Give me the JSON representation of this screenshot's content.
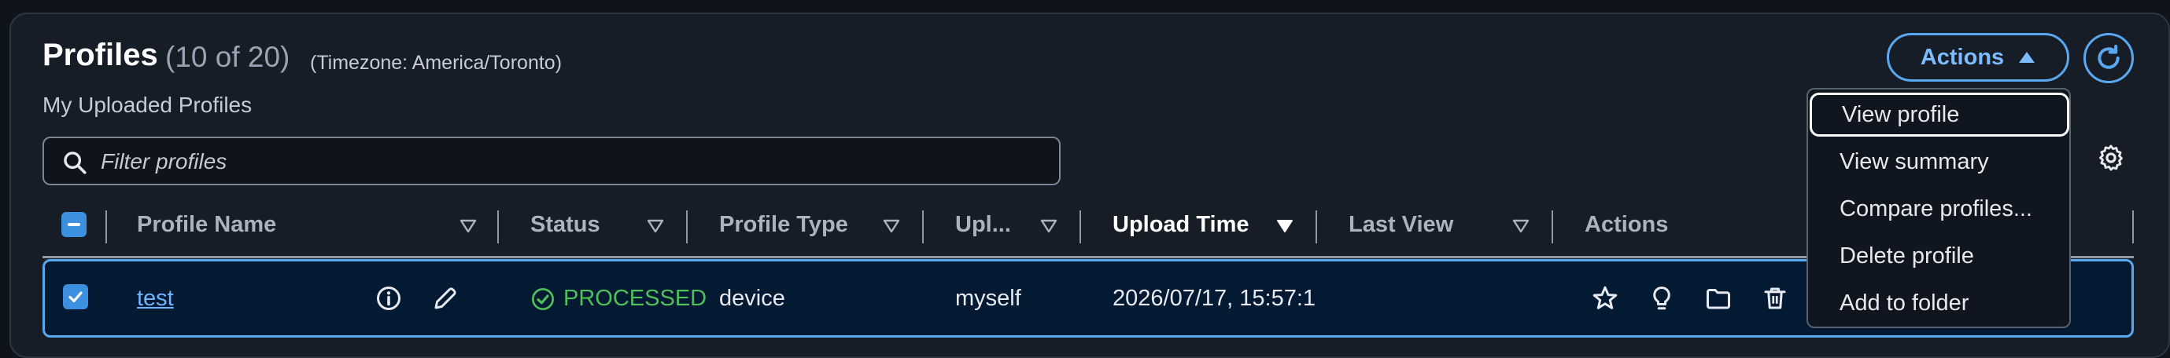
{
  "header": {
    "title": "Profiles",
    "count": "(10 of 20)",
    "timezone": "(Timezone: America/Toronto)",
    "subtitle": "My Uploaded Profiles",
    "actions_label": "Actions"
  },
  "search": {
    "placeholder": "Filter profiles",
    "value": ""
  },
  "table": {
    "columns": [
      "Profile Name",
      "Status",
      "Profile Type",
      "Upl...",
      "Upload Time",
      "Last View",
      "Actions"
    ],
    "sorted_column": "Upload Time",
    "header_checkbox": "indeterminate",
    "rows": [
      {
        "name": "test",
        "status": "PROCESSED",
        "type": "device",
        "uploader": "myself",
        "upload_time": "2026/07/17, 15:57:1",
        "last_view": "",
        "selected": true
      }
    ]
  },
  "menu": {
    "items": [
      "View profile",
      "View summary",
      "Compare profiles...",
      "Delete profile",
      "Add to folder"
    ],
    "focused_index": 0
  },
  "colors": {
    "accent": "#5aa8f0",
    "status_processed": "#4fbf5a",
    "background": "#161d27",
    "row_selected": "#041a33"
  },
  "icons": [
    "search-icon",
    "caret-up-icon",
    "refresh-icon",
    "gear-icon",
    "sort-caret-icon",
    "info-icon",
    "edit-icon",
    "check-circle-icon",
    "star-icon",
    "lightbulb-icon",
    "folder-icon",
    "trash-icon"
  ]
}
